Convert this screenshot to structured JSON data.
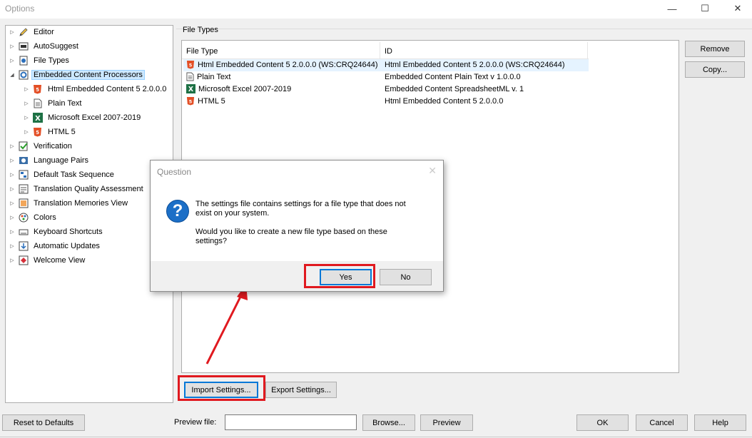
{
  "window": {
    "title": "Options"
  },
  "tree": {
    "items": [
      {
        "label": "Editor",
        "icon": "pencil-icon"
      },
      {
        "label": "AutoSuggest",
        "icon": "autosuggest-icon"
      },
      {
        "label": "File Types",
        "icon": "file-types-icon"
      },
      {
        "label": "Embedded Content Processors",
        "icon": "gear-icon",
        "selected": true
      },
      {
        "label": "Html Embedded Content 5 2.0.0.0",
        "icon": "html5-icon"
      },
      {
        "label": "Plain Text",
        "icon": "text-file-icon"
      },
      {
        "label": "Microsoft Excel 2007-2019",
        "icon": "excel-icon"
      },
      {
        "label": "HTML 5",
        "icon": "html5-icon"
      },
      {
        "label": "Verification",
        "icon": "verification-icon"
      },
      {
        "label": "Language Pairs",
        "icon": "language-pairs-icon"
      },
      {
        "label": "Default Task Sequence",
        "icon": "task-sequence-icon"
      },
      {
        "label": "Translation Quality Assessment",
        "icon": "tqa-icon"
      },
      {
        "label": "Translation Memories View",
        "icon": "tm-view-icon"
      },
      {
        "label": "Colors",
        "icon": "colors-icon"
      },
      {
        "label": "Keyboard Shortcuts",
        "icon": "keyboard-icon"
      },
      {
        "label": "Automatic Updates",
        "icon": "updates-icon"
      },
      {
        "label": "Welcome View",
        "icon": "welcome-icon"
      }
    ]
  },
  "file_types": {
    "group_label": "File Types",
    "columns": [
      "File Type",
      "ID"
    ],
    "rows": [
      {
        "name": "Html Embedded Content 5 2.0.0.0 (WS:CRQ24644)",
        "id": "Html Embedded Content 5 2.0.0.0 (WS:CRQ24644)",
        "icon": "html5-icon"
      },
      {
        "name": "Plain Text",
        "id": "Embedded Content Plain Text v 1.0.0.0",
        "icon": "text-file-icon"
      },
      {
        "name": "Microsoft Excel 2007-2019",
        "id": "Embedded Content SpreadsheetML v. 1",
        "icon": "excel-icon"
      },
      {
        "name": "HTML 5",
        "id": "Html Embedded Content 5 2.0.0.0",
        "icon": "html5-icon"
      }
    ],
    "remove_label": "Remove",
    "copy_label": "Copy...",
    "import_label": "Import Settings...",
    "export_label": "Export Settings..."
  },
  "bottom": {
    "reset_label": "Reset to Defaults",
    "preview_file_label": "Preview file:",
    "preview_file_value": "",
    "browse_label": "Browse...",
    "preview_label": "Preview",
    "ok_label": "OK",
    "cancel_label": "Cancel",
    "help_label": "Help"
  },
  "dialog": {
    "title": "Question",
    "message_line1": "The settings file contains settings for a file type that does not",
    "message_line2": "exist on your system.",
    "message_line3": "Would you like to create a new file type based on these",
    "message_line4": "settings?",
    "yes_label": "Yes",
    "no_label": "No",
    "icon": "question-icon"
  },
  "colors": {
    "annotation_red": "#e0191f",
    "selection_blue": "#cce8ff",
    "accent": "#0078d7"
  }
}
